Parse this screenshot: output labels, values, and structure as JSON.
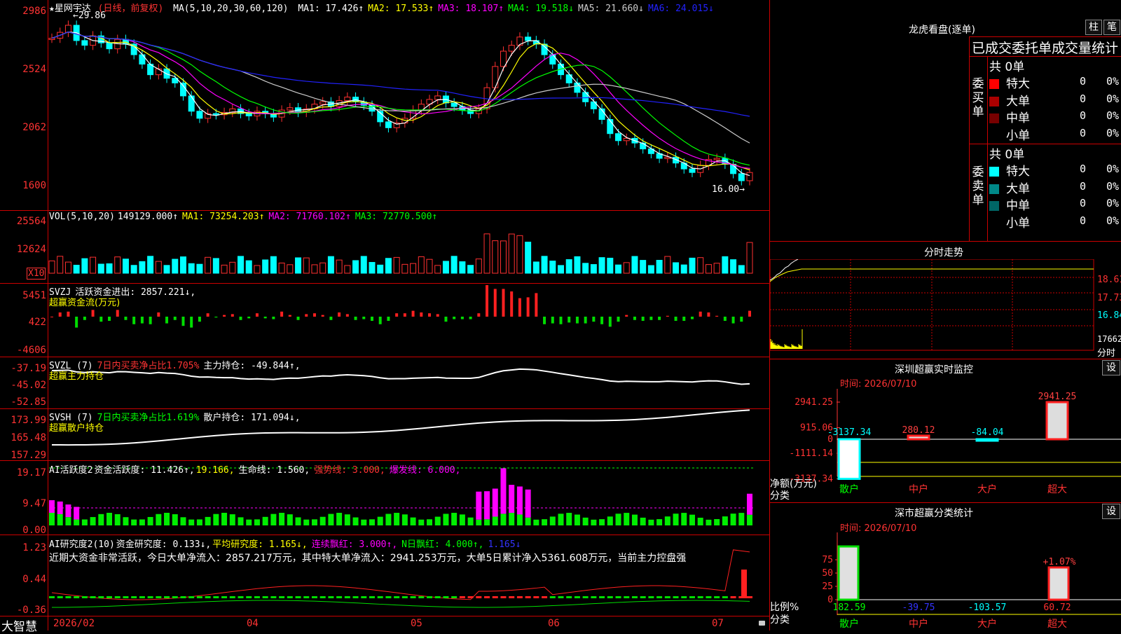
{
  "main": {
    "price_pane": {
      "symbol": "★星网宇达",
      "kline_type": "(日线，前复权)",
      "ma_params": "MA(5,10,20,30,60,120)",
      "ma": [
        {
          "label": "MA1:",
          "value": "17.426↑",
          "color": "#ffffff"
        },
        {
          "label": "MA2:",
          "value": "17.533↑",
          "color": "#ffff00"
        },
        {
          "label": "MA3:",
          "value": "18.107↑",
          "color": "#ff00ff"
        },
        {
          "label": "MA4:",
          "value": "19.518↓",
          "color": "#00ff00"
        },
        {
          "label": "MA5:",
          "value": "21.660↓",
          "color": "#cccccc"
        },
        {
          "label": "MA6:",
          "value": "24.015↓",
          "color": "#2222ff"
        }
      ],
      "y_ticks": [
        "2986",
        "2524",
        "2062",
        "1600"
      ],
      "high_marker": "←29.86",
      "low_marker": "16.00→"
    },
    "vol_pane": {
      "label": "VOL(5,10,20)",
      "value": "149129.000↑",
      "ma1": "MA1: 73254.203↑",
      "ma2": "MA2: 71760.102↑",
      "ma3": "MA3: 72770.500↑",
      "y_ticks": [
        "25564",
        "12624"
      ],
      "unit": "X10"
    },
    "svzj_pane": {
      "label": "SVZJ",
      "title": "活跃资金进出: 2857.221↓,",
      "subtitle": "超赢资金流(万元)",
      "y_ticks": [
        "5451",
        "422",
        "-4606"
      ]
    },
    "svzl_pane": {
      "label": "SVZL (7)",
      "ratio": "7日内买卖净占比1.705%",
      "title": "主力持仓: -49.844↑,",
      "subtitle": "超赢主力持仓",
      "y_ticks": [
        "-37.19",
        "-45.02",
        "-52.85"
      ]
    },
    "svsh_pane": {
      "label": "SVSH (7)",
      "ratio": "7日内买卖净占比1.619%",
      "title": "散户持仓: 171.094↓,",
      "subtitle": "超赢散户持仓",
      "y_ticks": [
        "173.99",
        "165.48",
        "157.29"
      ]
    },
    "active_pane": {
      "label": "AI活跃度2",
      "title": "资金活跃度: 11.426↑,",
      "v2": "19.166,",
      "v3": "生命线: 1.560,",
      "v4": "强势线: 3.000,",
      "v5": "爆发线: 6.000,",
      "y_ticks": [
        "19.17",
        "9.47",
        "0.00"
      ]
    },
    "research_pane": {
      "label": "AI研究度2(10)",
      "title": "资金研究度: 0.133↓,",
      "avg": "平均研究度: 1.165↓,",
      "streak": "连续飘红: 3.000↑,",
      "nred": "N日飘红: 4.000↑,",
      "v5": "1.165↓",
      "comment": "近期大资金非常活跃，今日大单净流入：2857.217万元，其中特大单净流入：2941.253万元，大单5日累计净入5361.608万元，当前主力控盘强",
      "y_ticks": [
        "1.23",
        "0.44",
        "-0.36"
      ]
    },
    "x_axis": {
      "app_name": "大智慧",
      "labels": [
        "2026/02",
        "04",
        "05",
        "06",
        "07"
      ]
    }
  },
  "right": {
    "dragon_title": "龙虎看盘(逐单)",
    "btn_bar": "柱",
    "btn_pen": "笔",
    "table_header": "已成交委托单成交量统计",
    "buy": {
      "side_label": "委买单",
      "total": "共 0单",
      "rows": [
        {
          "name": "特大",
          "vol": "0",
          "pct": "0%",
          "color": "#ff0000"
        },
        {
          "name": "大单",
          "vol": "0",
          "pct": "0%",
          "color": "#aa0000"
        },
        {
          "name": "中单",
          "vol": "0",
          "pct": "0%",
          "color": "#770000"
        },
        {
          "name": "小单",
          "vol": "0",
          "pct": "0%",
          "color": "#000000"
        }
      ]
    },
    "sell": {
      "side_label": "委卖单",
      "total": "共 0单",
      "rows": [
        {
          "name": "特大",
          "vol": "0",
          "pct": "0%",
          "color": "#00ffff"
        },
        {
          "name": "大单",
          "vol": "0",
          "pct": "0%",
          "color": "#008888"
        },
        {
          "name": "中单",
          "vol": "0",
          "pct": "0%",
          "color": "#006666"
        },
        {
          "name": "小单",
          "vol": "0",
          "pct": "0%",
          "color": "#000000"
        }
      ]
    },
    "intraday": {
      "title": "分时走势",
      "y_ticks": [
        "18.61",
        "17.73",
        "16.84"
      ],
      "vol_tick": "17662",
      "vol_unit": "分时"
    },
    "monitor": {
      "title": "深圳超赢实时监控",
      "btn": "设",
      "time": "时间: 2026/07/10",
      "y_ticks": [
        "2941.25",
        "915.06",
        "0",
        "-1111.14",
        "-3137.34"
      ],
      "axis_name": "净额(万元)",
      "axis_cat": "分类",
      "categories": [
        "散户",
        "中户",
        "大户",
        "超大"
      ],
      "bar_labels": [
        "-3137.34",
        "280.12",
        "-84.04",
        "2941.25"
      ],
      "bar_values": [
        -3137.34,
        280.12,
        -84.04,
        2941.25
      ]
    },
    "classify": {
      "title": "深市超赢分类统计",
      "btn": "设",
      "time": "时间: 2026/07/10",
      "y_ticks": [
        "75",
        "50",
        "25",
        "0"
      ],
      "axis_name": "比例%",
      "axis_cat": "分类",
      "categories": [
        "散户",
        "中户",
        "大户",
        "超大"
      ],
      "bottom_values": [
        "182.59",
        "-39.75",
        "-103.57",
        "60.72"
      ],
      "top_label": "+1.07%"
    }
  }
}
